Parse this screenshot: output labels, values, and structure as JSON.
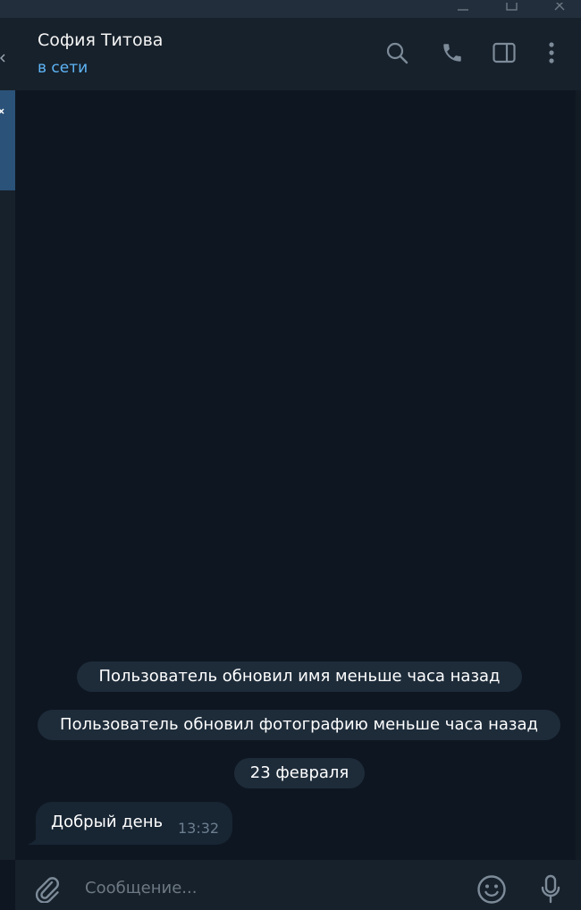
{
  "header": {
    "contact_name": "София Титова",
    "status": "в сети"
  },
  "service_messages": [
    "Пользователь обновил имя меньше часа назад",
    "Пользователь обновил фотографию меньше часа назад",
    "23 февраля"
  ],
  "messages": [
    {
      "text": "Добрый день",
      "time": "13:32",
      "direction": "incoming"
    }
  ],
  "composer": {
    "placeholder": "Сообщение..."
  },
  "icons": {
    "window_controls": [
      "minimize-icon",
      "maximize-icon",
      "close-icon"
    ],
    "header_actions": [
      "search-icon",
      "phone-icon",
      "sidebar-toggle-icon",
      "more-vertical-icon"
    ],
    "composer_actions": [
      "paperclip-icon",
      "emoji-icon",
      "microphone-icon"
    ]
  },
  "colors": {
    "background": "#0e1621",
    "header": "#17212b",
    "accent": "#5eb5f7",
    "active_chat": "#2b5278",
    "bubble": "#182533",
    "service_pill": "#1e2c3a"
  }
}
